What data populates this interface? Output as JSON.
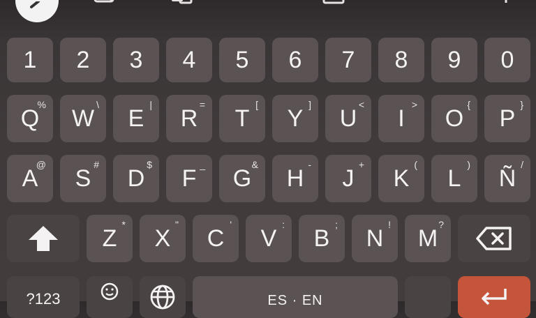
{
  "rows": {
    "numbers": [
      "1",
      "2",
      "3",
      "4",
      "5",
      "6",
      "7",
      "8",
      "9",
      "0"
    ],
    "row1": [
      {
        "label": "Q",
        "sec": "%"
      },
      {
        "label": "W",
        "sec": "\\"
      },
      {
        "label": "E",
        "sec": "|"
      },
      {
        "label": "R",
        "sec": "="
      },
      {
        "label": "T",
        "sec": "["
      },
      {
        "label": "Y",
        "sec": "]"
      },
      {
        "label": "U",
        "sec": "<"
      },
      {
        "label": "I",
        "sec": ">"
      },
      {
        "label": "O",
        "sec": "{"
      },
      {
        "label": "P",
        "sec": "}"
      }
    ],
    "row2": [
      {
        "label": "A",
        "sec": "@"
      },
      {
        "label": "S",
        "sec": "#"
      },
      {
        "label": "D",
        "sec": "$"
      },
      {
        "label": "F",
        "sec": "_"
      },
      {
        "label": "G",
        "sec": "&"
      },
      {
        "label": "H",
        "sec": "-"
      },
      {
        "label": "J",
        "sec": "+"
      },
      {
        "label": "K",
        "sec": "("
      },
      {
        "label": "L",
        "sec": ")"
      },
      {
        "label": "Ñ",
        "sec": "/"
      }
    ],
    "row3": [
      {
        "label": "Z",
        "sec": "*"
      },
      {
        "label": "X",
        "sec": "\""
      },
      {
        "label": "C",
        "sec": "'"
      },
      {
        "label": "V",
        "sec": ":"
      },
      {
        "label": "B",
        "sec": ";"
      },
      {
        "label": "N",
        "sec": "!"
      },
      {
        "label": "M",
        "sec": "?"
      }
    ]
  },
  "bottom": {
    "symbols_label": "?123",
    "space_label": "ES · EN"
  },
  "icons": {
    "back": "chevron-left-icon",
    "shift": "shift-arrow-icon",
    "backspace": "backspace-icon",
    "emoji": "emoji-icon",
    "globe": "globe-icon",
    "enter": "enter-icon"
  },
  "colors": {
    "key": "#5a5253",
    "function_key": "#4a4344",
    "enter": "#c4553a",
    "background": "#3a3536"
  }
}
